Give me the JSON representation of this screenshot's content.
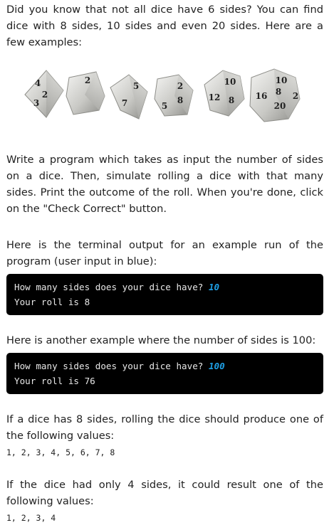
{
  "intro": "Did you know that not all dice have 6 sides? You can find dice with 8 sides, 10 sides and even 20 sides. Here are a few examples:",
  "dice_image": {
    "description": "six metallic dice",
    "numbers": [
      "4",
      "2",
      "3",
      "2",
      "5",
      "7",
      "2",
      "8",
      "5",
      "10",
      "12",
      "8",
      "10",
      "8",
      "16",
      "20",
      "2"
    ]
  },
  "task": "Write a program which takes as input the number of sides on a dice. Then, simulate rolling a dice with that many sides. Print the outcome of the roll. When you're done, click on the \"Check Correct\" button.",
  "example1_intro": "Here is the terminal output for an example run of the program (user input in blue):",
  "example1": {
    "prompt": "How many sides does your dice have? ",
    "input": "10",
    "output": "Your roll is 8"
  },
  "example2_intro": "Here is another example where the number of sides is 100:",
  "example2": {
    "prompt": "How many sides does your dice have? ",
    "input": "100",
    "output": "Your roll is 76"
  },
  "values8_intro": "If a dice has 8 sides, rolling the dice should produce one of the following values:",
  "values8": "1, 2, 3, 4, 5, 6, 7, 8",
  "values4_intro": "If the dice had only 4 sides, it could result one of the following values:",
  "values4": "1, 2, 3, 4",
  "colors": {
    "terminal_bg": "#000000",
    "user_input": "#1ea0e6"
  }
}
